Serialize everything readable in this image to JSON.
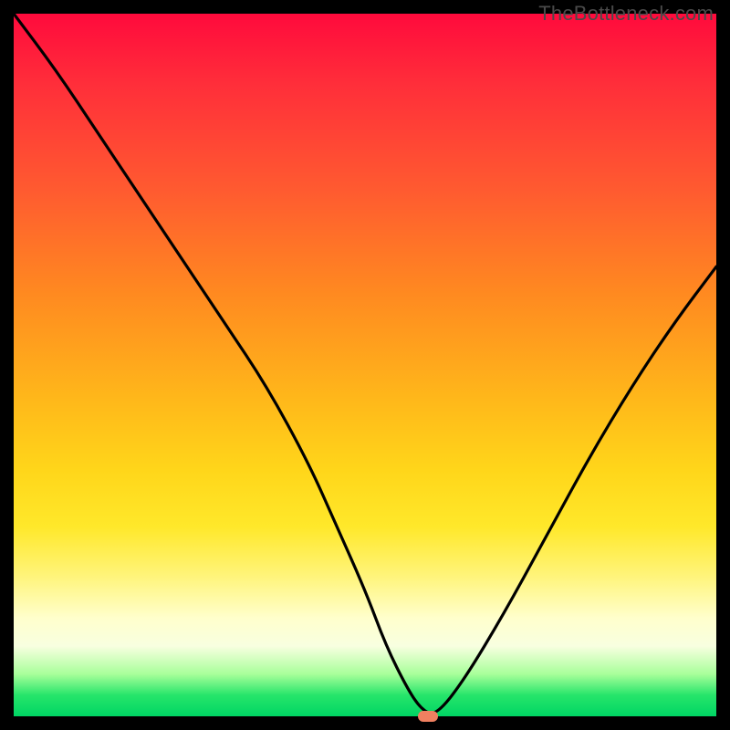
{
  "watermark": "TheBottleneck.com",
  "colors": {
    "frame_bg": "#000000",
    "gradient_top": "#ff0a3c",
    "gradient_bottom": "#00d564",
    "curve_stroke": "#000000",
    "marker_fill": "#f08060"
  },
  "chart_data": {
    "type": "line",
    "title": "",
    "xlabel": "",
    "ylabel": "",
    "xlim": [
      0,
      100
    ],
    "ylim": [
      0,
      100
    ],
    "grid": false,
    "legend": false,
    "series": [
      {
        "name": "bottleneck-curve",
        "x": [
          0,
          6,
          12,
          18,
          24,
          30,
          36,
          42,
          46,
          50,
          53,
          56,
          58,
          60,
          64,
          70,
          76,
          82,
          88,
          94,
          100
        ],
        "y": [
          100,
          92,
          83,
          74,
          65,
          56,
          47,
          36,
          27,
          18,
          10,
          4,
          1,
          0,
          5,
          15,
          26,
          37,
          47,
          56,
          64
        ]
      }
    ],
    "marker": {
      "x": 59,
      "y": 0,
      "shape": "pill"
    },
    "background_gradient": {
      "direction": "vertical",
      "stops": [
        {
          "pos": 0.0,
          "color": "#ff0a3c"
        },
        {
          "pos": 0.25,
          "color": "#ff5a30"
        },
        {
          "pos": 0.55,
          "color": "#ffb81a"
        },
        {
          "pos": 0.8,
          "color": "#fff47a"
        },
        {
          "pos": 0.94,
          "color": "#a8ff9a"
        },
        {
          "pos": 1.0,
          "color": "#00d564"
        }
      ]
    }
  }
}
